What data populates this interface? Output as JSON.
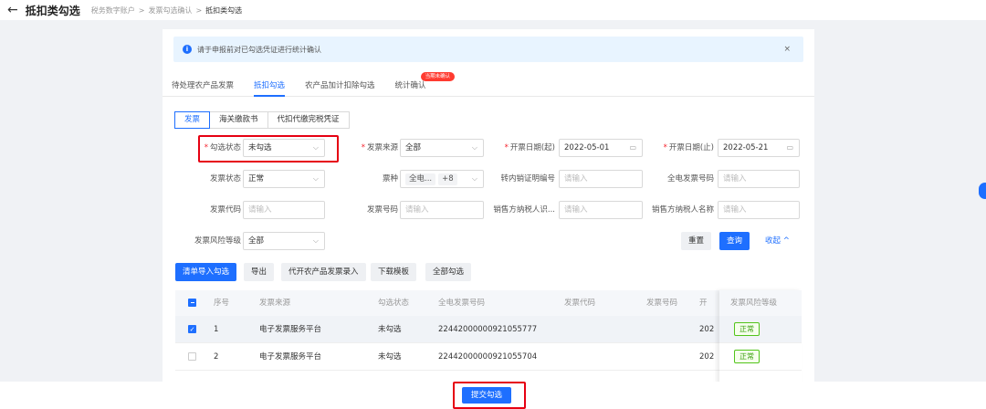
{
  "header": {
    "back_icon": "←",
    "title": "抵扣类勾选",
    "breadcrumbs": [
      "税务数字账户",
      "发票勾选确认",
      "抵扣类勾选"
    ],
    "separator": ">"
  },
  "alert": {
    "text": "请于申报前对已勾选凭证进行统计确认",
    "close": "×"
  },
  "tabs": [
    {
      "label": "待处理农产品发票"
    },
    {
      "label": "抵扣勾选"
    },
    {
      "label": "农产品加计扣除勾选"
    },
    {
      "label": "统计确认",
      "badge": "当期未确认"
    }
  ],
  "subtabs": [
    "发票",
    "海关缴款书",
    "代扣代缴完税凭证"
  ],
  "filters": {
    "check_status": {
      "label": "勾选状态",
      "value": "未勾选"
    },
    "invoice_source": {
      "label": "发票来源",
      "value": "全部"
    },
    "date_start": {
      "label": "开票日期(起)",
      "value": "2022-05-01"
    },
    "date_end": {
      "label": "开票日期(止)",
      "value": "2022-05-21"
    },
    "invoice_status": {
      "label": "发票状态",
      "value": "正常"
    },
    "invoice_type": {
      "label": "票种",
      "tag": "全电...",
      "more": "+8"
    },
    "transfer_no": {
      "label": "转内销证明编号",
      "placeholder": "请输入"
    },
    "full_invoice_no": {
      "label": "全电发票号码",
      "placeholder": "请输入"
    },
    "invoice_code": {
      "label": "发票代码",
      "placeholder": "请输入"
    },
    "invoice_number": {
      "label": "发票号码",
      "placeholder": "请输入"
    },
    "seller_tax_id": {
      "label": "销售方纳税人识...",
      "placeholder": "请输入"
    },
    "seller_name": {
      "label": "销售方纳税人名称",
      "placeholder": "请输入"
    },
    "risk_level": {
      "label": "发票风险等级",
      "value": "全部"
    }
  },
  "actions": {
    "reset": "重置",
    "query": "查询",
    "collapse": "收起 ^"
  },
  "toolbar": [
    "清单导入勾选",
    "导出",
    "代开农产品发票录入",
    "下载模板",
    "全部勾选"
  ],
  "table": {
    "headers": [
      "序号",
      "发票来源",
      "勾选状态",
      "全电发票号码",
      "发票代码",
      "发票号码",
      "开",
      "发票风险等级"
    ],
    "rows": [
      {
        "index": "1",
        "source": "电子发票服务平台",
        "status": "未勾选",
        "full_no": "22442000000921055777",
        "date_prefix": "202",
        "risk": "正常"
      },
      {
        "index": "2",
        "source": "电子发票服务平台",
        "status": "未勾选",
        "full_no": "22442000000921055704",
        "date_prefix": "202",
        "risk": "正常"
      }
    ]
  },
  "submit": "提交勾选",
  "colors": {
    "accent": "#1e6fff",
    "highlight": "#e60012",
    "success": "#52c41a"
  }
}
